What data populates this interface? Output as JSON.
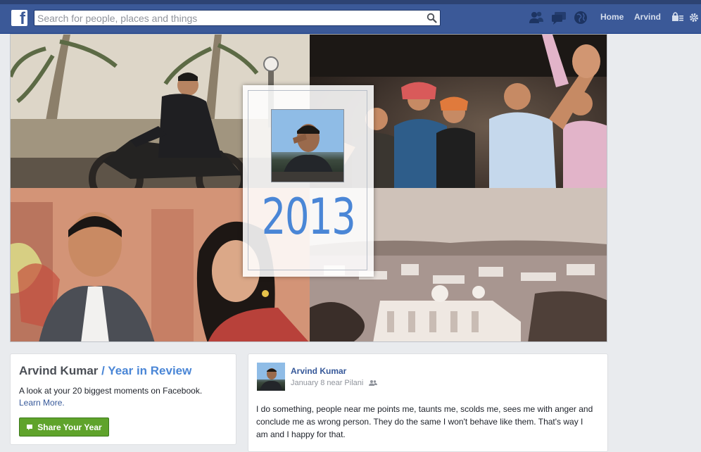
{
  "topbar": {
    "logo": "f",
    "search_placeholder": "Search for people, places and things",
    "icons": [
      "friend-requests-icon",
      "messages-icon",
      "notifications-globe-icon",
      "privacy-shortcuts-icon",
      "settings-gear-icon"
    ],
    "nav": {
      "home": "Home",
      "profile": "Arvind"
    }
  },
  "cover": {
    "year": "2013"
  },
  "year_review": {
    "name": "Arvind Kumar",
    "title_suffix": "/ Year in Review",
    "description": "A look at your 20 biggest moments on Facebook.",
    "learn_more": "Learn More.",
    "share_button": "Share Your Year"
  },
  "post": {
    "author": "Arvind Kumar",
    "meta": "January 8 near Pilani",
    "body": "I do something, people near me points me, taunts me, scolds me, sees me with anger and conclude me as wrong person. They do the same I won't behave like them. That's way I am and I happy for that."
  },
  "colors": {
    "topbar": "#3b5998",
    "accent_blue": "#4a86d6",
    "link": "#365899",
    "share_green": "#5fa32b"
  }
}
